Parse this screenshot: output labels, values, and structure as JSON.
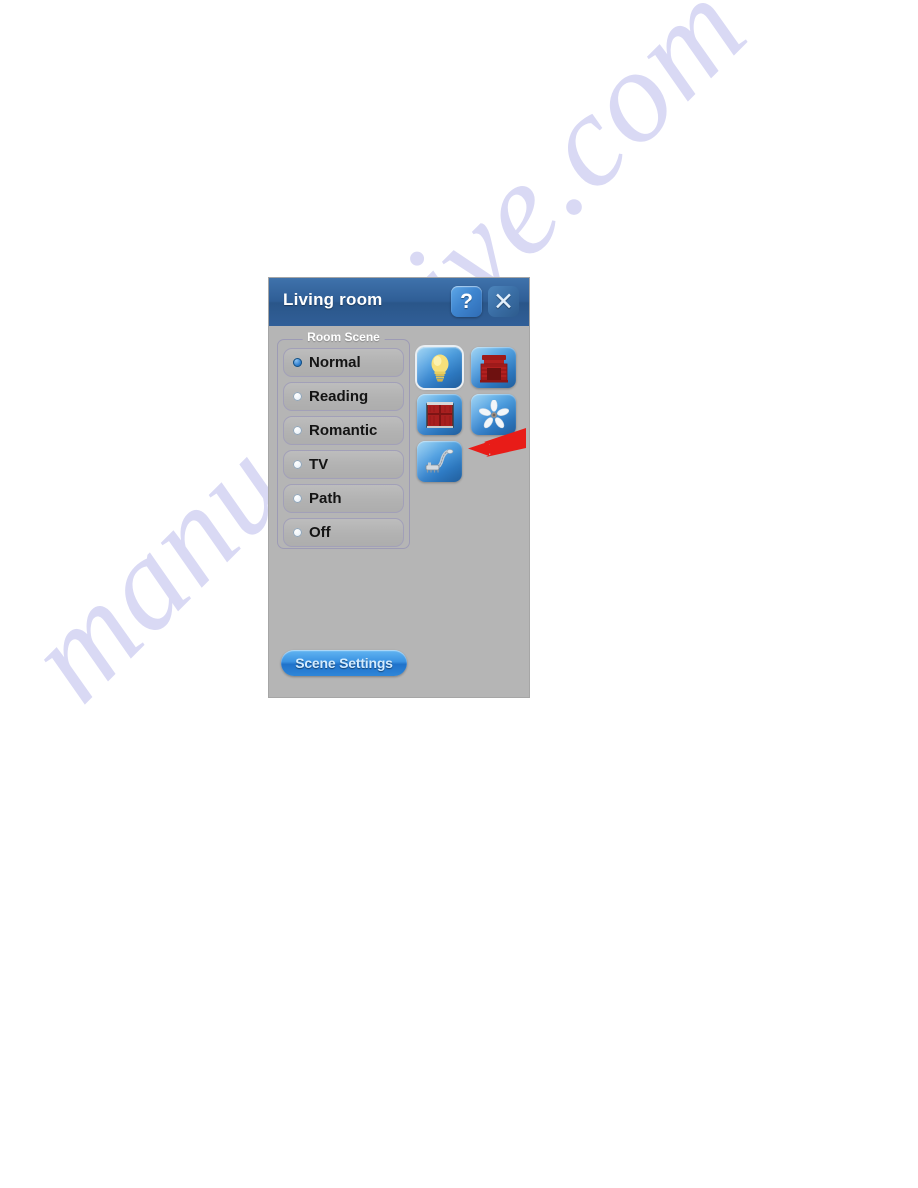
{
  "watermark": {
    "text": "manualshive.com",
    "color": "#d9d9f4"
  },
  "dialog": {
    "title": "Living room",
    "background_color": "#b5b5b5",
    "titlebar_color": "#2f5e96",
    "buttons": {
      "help": {
        "label": "?",
        "icon": "question-mark-icon"
      },
      "close": {
        "label": "✕",
        "icon": "close-icon"
      }
    },
    "scene_group": {
      "legend": "Room Scene",
      "selected": "Normal",
      "options": [
        {
          "label": "Normal",
          "selected": true
        },
        {
          "label": "Reading",
          "selected": false
        },
        {
          "label": "Romantic",
          "selected": false
        },
        {
          "label": "TV",
          "selected": false
        },
        {
          "label": "Path",
          "selected": false
        },
        {
          "label": "Off",
          "selected": false
        }
      ]
    },
    "device_icons": [
      {
        "name": "light-bulb-icon",
        "label": "Light",
        "selected": true,
        "accent": "#f2d35c"
      },
      {
        "name": "fireplace-icon",
        "label": "Fireplace",
        "selected": false,
        "accent": "#b3201f"
      },
      {
        "name": "curtain-icon",
        "label": "Curtain",
        "selected": false,
        "accent": "#a81f1f"
      },
      {
        "name": "fan-icon",
        "label": "Fan",
        "selected": false,
        "accent": "#f0f3f6"
      },
      {
        "name": "shower-icon",
        "label": "Shower",
        "selected": false,
        "accent": "#c9cfd6"
      }
    ],
    "scene_settings_button": "Scene Settings"
  },
  "annotation": {
    "arrow_color": "#e81c18",
    "points_to": "shower-icon"
  }
}
